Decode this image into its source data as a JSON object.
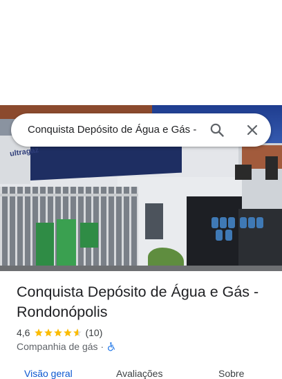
{
  "search": {
    "query": "Conquista Depósito de Água e Gás -"
  },
  "photo": {
    "brand_text": "ultragaz"
  },
  "place": {
    "name": "Conquista Depósito de Água e Gás - Rondonópolis",
    "rating": "4,6",
    "rating_value": 4.6,
    "reviews_count": "(10)",
    "category": "Companhia de gás",
    "separator": "·"
  },
  "tabs": [
    {
      "label": "Visão geral",
      "active": true
    },
    {
      "label": "Avaliações",
      "active": false
    },
    {
      "label": "Sobre",
      "active": false
    }
  ],
  "colors": {
    "accent": "#0b57d0",
    "star": "#fbbc04",
    "wheelchair": "#1a73e8"
  },
  "icons": {
    "search": "search-icon",
    "close": "close-icon",
    "wheelchair": "wheelchair-icon",
    "star": "star-icon"
  }
}
